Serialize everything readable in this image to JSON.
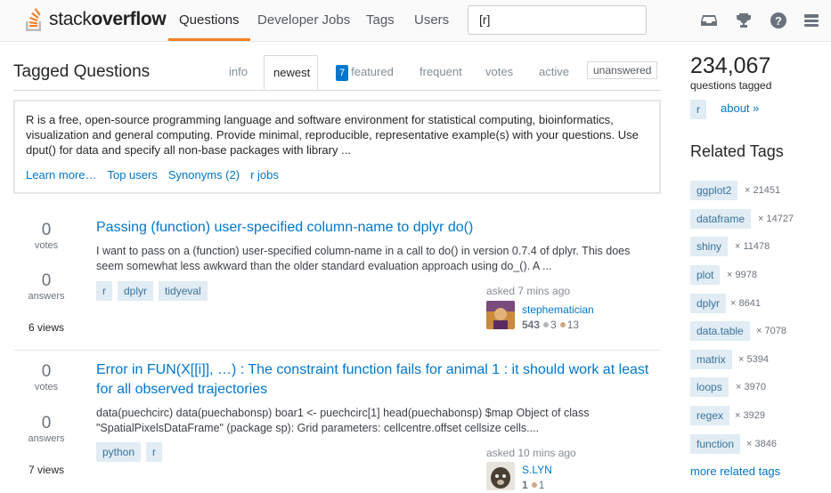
{
  "header": {
    "logo_prefix": "stack",
    "logo_bold": "overflow",
    "nav": [
      {
        "label": "Questions",
        "active": true
      },
      {
        "label": "Developer Jobs",
        "active": false
      },
      {
        "label": "Tags",
        "active": false
      },
      {
        "label": "Users",
        "active": false
      }
    ],
    "search_value": "[r]",
    "icons": [
      "inbox-icon",
      "trophy-icon",
      "help-icon",
      "menu-icon"
    ]
  },
  "main": {
    "title": "Tagged Questions",
    "tabs": {
      "info": "info",
      "newest": "newest",
      "featured_count": "7",
      "featured": "featured",
      "frequent": "frequent",
      "votes": "votes",
      "active": "active",
      "unanswered": "unanswered"
    },
    "wiki": {
      "text": "R is a free, open-source programming language and software environment for statistical computing, bioinformatics, visualization and general computing. Provide minimal, reproducible, representative example(s) with your questions. Use dput() for data and specify all non-base packages with library ...",
      "links": [
        "Learn more…",
        "Top users",
        "Synonyms (2)",
        "r jobs"
      ]
    },
    "questions": [
      {
        "votes": "0",
        "votes_label": "votes",
        "answers": "0",
        "answers_label": "answers",
        "views": "6 views",
        "title": "Passing (function) user-specified column-name to dplyr do()",
        "excerpt": "I want to pass on a (function) user-specified column-name in a call to do() in version 0.7.4 of dplyr. This does seem somewhat less awkward than the older standard evaluation approach using do_(). A ...",
        "tags": [
          "r",
          "dplyr",
          "tidyeval"
        ],
        "asked": "asked 7 mins ago",
        "user": "stephematician",
        "rep": "543",
        "silver": "3",
        "bronze": "13"
      },
      {
        "votes": "0",
        "votes_label": "votes",
        "answers": "0",
        "answers_label": "answers",
        "views": "7 views",
        "title": "Error in FUN(X[[i]], …) : The constraint function fails for animal 1 : it should work at least for all observed trajectories",
        "excerpt": "data(puechcirc) data(puechabonsp) boar1 <- puechcirc[1] head(puechabonsp) $map Object of class \"SpatialPixelsDataFrame\" (package sp): Grid parameters: cellcentre.offset cellsize cells....",
        "tags": [
          "python",
          "r"
        ],
        "asked": "asked 10 mins ago",
        "user": "S.LYN",
        "rep": "1",
        "bronze": "1"
      }
    ]
  },
  "sidebar": {
    "count": "234,067",
    "count_label": "questions tagged",
    "tag": "r",
    "about": "about »",
    "related_title": "Related Tags",
    "related": [
      {
        "tag": "ggplot2",
        "count": "× 21451"
      },
      {
        "tag": "dataframe",
        "count": "× 14727"
      },
      {
        "tag": "shiny",
        "count": "× 11478"
      },
      {
        "tag": "plot",
        "count": "× 9978"
      },
      {
        "tag": "dplyr",
        "count": "× 8641"
      },
      {
        "tag": "data.table",
        "count": "× 7078"
      },
      {
        "tag": "matrix",
        "count": "× 5394"
      },
      {
        "tag": "loops",
        "count": "× 3970"
      },
      {
        "tag": "regex",
        "count": "× 3929"
      },
      {
        "tag": "function",
        "count": "× 3846"
      }
    ],
    "more": "more related tags"
  },
  "colors": {
    "accent": "#f48024",
    "link": "#0077cc",
    "tag_bg": "#e1ecf4",
    "tag_fg": "#39739d"
  }
}
